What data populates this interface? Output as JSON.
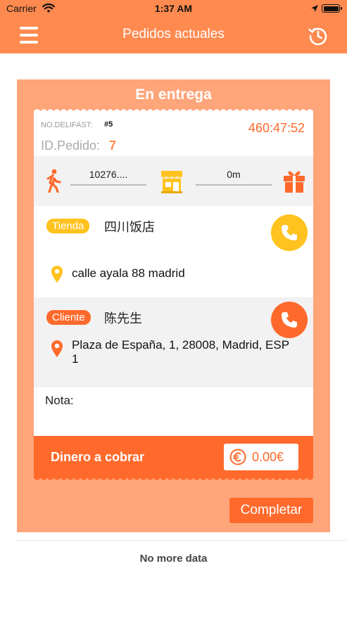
{
  "status_bar": {
    "carrier": "Carrier",
    "time": "1:37 AM"
  },
  "header": {
    "title": "Pedidos actuales",
    "menu_icon": "hamburger-menu-icon",
    "history_icon": "history-clock-icon",
    "bg_color": "#ff8a4f"
  },
  "order_card": {
    "heading": "En entrega",
    "delifast_label": "NO.DELIFAST:",
    "delifast_number": "#5",
    "timer": "460:47:52",
    "id_label": "ID.Pedido:",
    "id_value": "7",
    "route": {
      "walk_icon": "walking-person-icon",
      "distance_to_store": "10276....",
      "store_icon": "store-icon",
      "distance_to_client": "0m",
      "gift_icon": "gift-icon"
    },
    "store": {
      "tag": "Tienda",
      "name": "四川饭店",
      "address": "calle ayala 88 madrid",
      "pin_icon": "location-pin-icon",
      "call_icon": "phone-icon"
    },
    "client": {
      "tag": "Cliente",
      "name": "陈先生",
      "address": "Plaza de España, 1, 28008, Madrid, ESP 1",
      "pin_icon": "location-pin-icon",
      "call_icon": "phone-icon"
    },
    "note_label": "Nota:",
    "payment": {
      "label": "Dinero a cobrar",
      "amount": "0.00€",
      "euro_icon": "euro-coin-icon"
    },
    "complete_button": "Completar"
  },
  "footer": {
    "no_more": "No more data"
  },
  "colors": {
    "brand_orange": "#ff8a4f",
    "accent_orange": "#ff6a2c",
    "card_bg": "#ffa57a",
    "store_yellow": "#ffc21e"
  }
}
